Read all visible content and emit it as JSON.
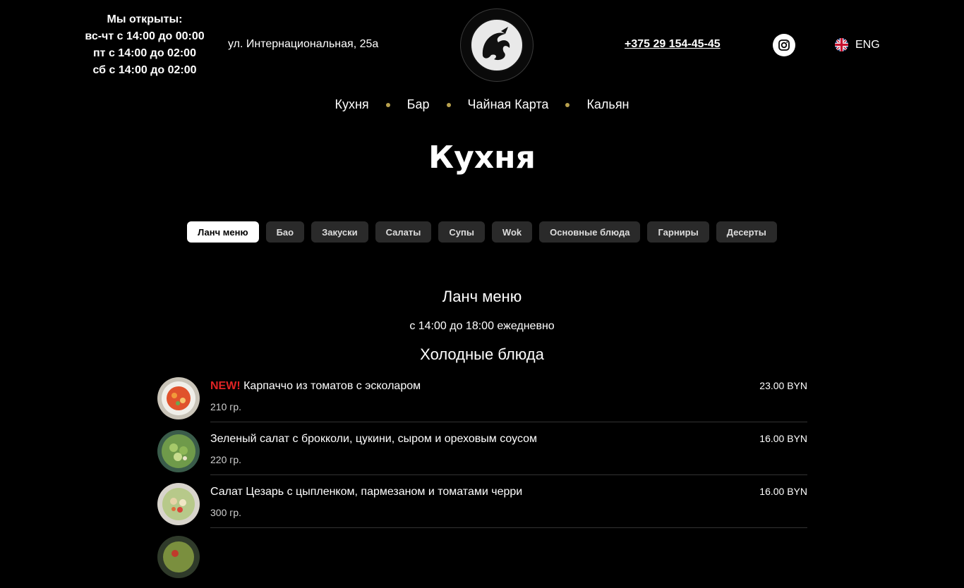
{
  "header": {
    "hours": [
      "Мы открыты:",
      "вс-чт с 14:00 до 00:00",
      "пт с 14:00 до 02:00",
      "сб с 14:00 до 02:00"
    ],
    "address": "ул. Интернациональная, 25а",
    "phone": "+375 29 154-45-45",
    "instagram_icon": "instagram-icon",
    "language": "ENG",
    "flag_icon": "uk-flag-icon"
  },
  "nav": [
    "Кухня",
    "Бар",
    "Чайная Карта",
    "Кальян"
  ],
  "page_title": "Кухня",
  "categories": [
    "Ланч меню",
    "Бао",
    "Закуски",
    "Салаты",
    "Супы",
    "Wok",
    "Основные блюда",
    "Гарниры",
    "Десерты"
  ],
  "active_category": "Ланч меню",
  "section": {
    "title": "Ланч меню",
    "subtitle": "с 14:00 до 18:00 ежедневно",
    "group_title": "Холодные блюда"
  },
  "items": [
    {
      "badge": "NEW!",
      "name": "Карпаччо из томатов с эсколаром",
      "weight": "210 гр.",
      "price": "23.00 BYN"
    },
    {
      "badge": "",
      "name": "Зеленый салат с брокколи, цукини, сыром и ореховым соусом",
      "weight": "220 гр.",
      "price": "16.00 BYN"
    },
    {
      "badge": "",
      "name": "Салат Цезарь с цыпленком, пармезаном и томатами черри",
      "weight": "300 гр.",
      "price": "16.00 BYN"
    }
  ],
  "colors": {
    "background": "#000000",
    "accent_dot": "#b9a14e",
    "new_badge": "#e02424",
    "chip": "#2a2a2a"
  }
}
